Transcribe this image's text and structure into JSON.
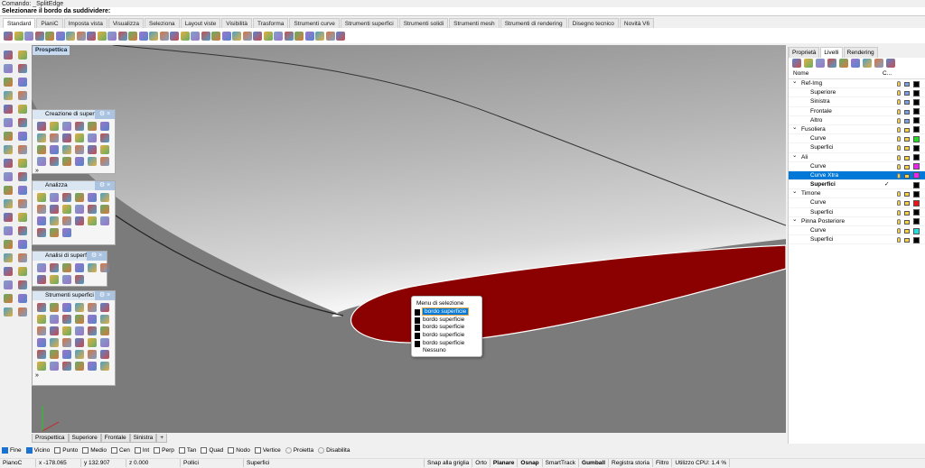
{
  "command": {
    "history": "Comando: _SplitEdge",
    "prompt": "Selezionare il bordo da suddividere:"
  },
  "tabs": [
    "Standard",
    "PianiC",
    "Imposta vista",
    "Visualizza",
    "Seleziona",
    "Layout viste",
    "Visibilità",
    "Trasforma",
    "Strumenti curve",
    "Strumenti superfici",
    "Strumenti solidi",
    "Strumenti mesh",
    "Strumenti di rendering",
    "Disegno tecnico",
    "Novità V6"
  ],
  "toolbar_icons": [
    "new-file",
    "open-file",
    "save",
    "print",
    "import",
    "cut",
    "copy",
    "paste",
    "undo",
    "pan-hand",
    "move-view",
    "zoom-in",
    "zoom-window",
    "zoom-extents",
    "zoom-selected",
    "rotate-view",
    "four-viewports",
    "construction-plane",
    "set-view",
    "grid",
    "osnap",
    "light",
    "lock",
    "render-material",
    "color-wheel",
    "shaded",
    "rendered",
    "globe",
    "hide",
    "options",
    "layout",
    "plugin",
    "help"
  ],
  "viewport": {
    "title": "Prospettica",
    "tabs": [
      "Prospettica",
      "Superiore",
      "Frontale",
      "Sinistra"
    ],
    "add_tab": "+"
  },
  "palettes": [
    {
      "title": "Creazione di superfici",
      "count": 24
    },
    {
      "title": "Analizza",
      "count": 21
    },
    {
      "title": "Analisi di superfici",
      "count": 10
    },
    {
      "title": "Strumenti superfici",
      "count": 36
    }
  ],
  "palette_more": "»",
  "selection_menu": {
    "title": "Menu di selezione",
    "items": [
      "bordo superficie",
      "bordo superficie",
      "bordo superficie",
      "bordo superficie",
      "bordo superficie"
    ],
    "none": "Nessuno"
  },
  "panel": {
    "tabs": [
      "Proprietà",
      "Livelli",
      "Rendering"
    ],
    "col_name": "Nome",
    "col_current": "C...",
    "layers": [
      {
        "name": "Ref-Img",
        "level": 0,
        "color": "#000000",
        "locked": true
      },
      {
        "name": "Superiore",
        "level": 1,
        "color": "#000000",
        "locked": true
      },
      {
        "name": "Sinistra",
        "level": 1,
        "color": "#000000",
        "locked": true
      },
      {
        "name": "Frontale",
        "level": 1,
        "color": "#000000",
        "locked": true
      },
      {
        "name": "Altro",
        "level": 1,
        "color": "#000000",
        "locked": true
      },
      {
        "name": "Fusoliera",
        "level": 0,
        "color": "#000000"
      },
      {
        "name": "Curve",
        "level": 1,
        "color": "#22dd22"
      },
      {
        "name": "Superfici",
        "level": 1,
        "color": "#000000"
      },
      {
        "name": "Ali",
        "level": 0,
        "color": "#000000"
      },
      {
        "name": "Curve",
        "level": 1,
        "color": "#ee22ee"
      },
      {
        "name": "Curve Xtra",
        "level": 1,
        "color": "#ee22ee",
        "selected": true
      },
      {
        "name": "Superfici",
        "level": 1,
        "color": "#000000",
        "current": true
      },
      {
        "name": "Timone",
        "level": 0,
        "color": "#000000"
      },
      {
        "name": "Curve",
        "level": 1,
        "color": "#ee1111"
      },
      {
        "name": "Superfici",
        "level": 1,
        "color": "#000000"
      },
      {
        "name": "Pinna Posteriore",
        "level": 0,
        "color": "#000000"
      },
      {
        "name": "Curve",
        "level": 1,
        "color": "#22dddd"
      },
      {
        "name": "Superfici",
        "level": 1,
        "color": "#000000"
      }
    ],
    "current_mark": "✓"
  },
  "osnaps": [
    {
      "label": "Fine",
      "on": true
    },
    {
      "label": "Vicino",
      "on": true
    },
    {
      "label": "Punto",
      "on": false
    },
    {
      "label": "Medio",
      "on": false
    },
    {
      "label": "Cen",
      "on": false
    },
    {
      "label": "Int",
      "on": false
    },
    {
      "label": "Perp",
      "on": false
    },
    {
      "label": "Tan",
      "on": false
    },
    {
      "label": "Quad",
      "on": false
    },
    {
      "label": "Nodo",
      "on": false
    },
    {
      "label": "Vertice",
      "on": false
    }
  ],
  "osnap_radio": [
    "Proietta",
    "Disabilita"
  ],
  "status": {
    "cplane": "PianoC",
    "x": "x -178.065",
    "y": "y 132.907",
    "z": "z 0.000",
    "units": "Pollici",
    "layer": "Superfici",
    "toggles": [
      {
        "label": "Snap alla griglia",
        "bold": false
      },
      {
        "label": "Orto",
        "bold": false
      },
      {
        "label": "Planare",
        "bold": true
      },
      {
        "label": "Osnap",
        "bold": true
      },
      {
        "label": "SmartTrack",
        "bold": false
      },
      {
        "label": "Gumball",
        "bold": true
      },
      {
        "label": "Registra storia",
        "bold": false
      },
      {
        "label": "Filtro",
        "bold": false
      }
    ],
    "cpu": "Utilizzo CPU: 1.4 %"
  }
}
